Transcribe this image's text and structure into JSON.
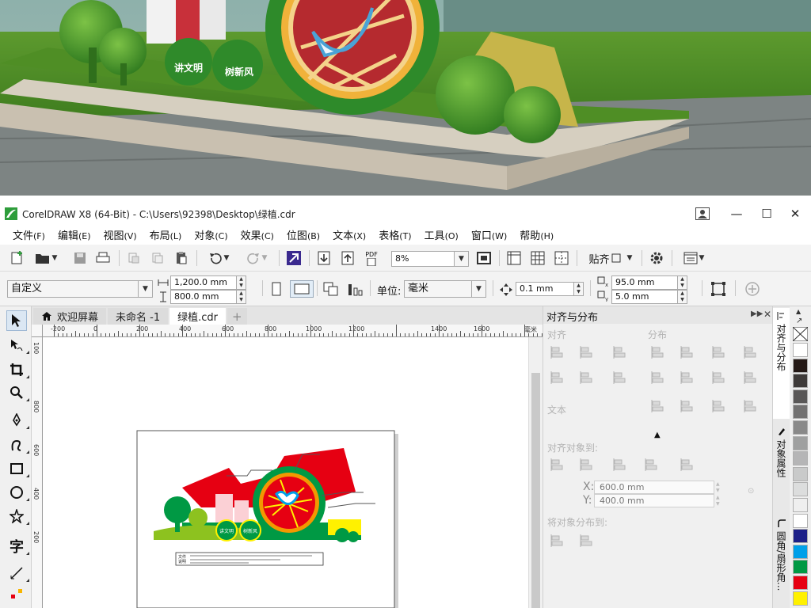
{
  "window": {
    "title": "CorelDRAW X8 (64-Bit) - C:\\Users\\92398\\Desktop\\绿植.cdr",
    "minimize_glyph": "—",
    "maximize_glyph": "☐",
    "close_glyph": "✕"
  },
  "render_scene": {
    "sign_text_left": "讲文明",
    "sign_text_right": "树新风"
  },
  "menu": [
    {
      "label": "文件",
      "accel": "(F)"
    },
    {
      "label": "编辑",
      "accel": "(E)"
    },
    {
      "label": "视图",
      "accel": "(V)"
    },
    {
      "label": "布局",
      "accel": "(L)"
    },
    {
      "label": "对象",
      "accel": "(C)"
    },
    {
      "label": "效果",
      "accel": "(C)"
    },
    {
      "label": "位图",
      "accel": "(B)"
    },
    {
      "label": "文本",
      "accel": "(X)"
    },
    {
      "label": "表格",
      "accel": "(T)"
    },
    {
      "label": "工具",
      "accel": "(O)"
    },
    {
      "label": "窗口",
      "accel": "(W)"
    },
    {
      "label": "帮助",
      "accel": "(H)"
    }
  ],
  "toolbar": {
    "zoom_value": "8%",
    "snap_label": "贴齐",
    "pdf_label": "PDF"
  },
  "propbar": {
    "paper_preset": "自定义",
    "width_value": "1,200.0 mm",
    "height_value": "800.0 mm",
    "units_label": "单位:",
    "units_value": "毫米",
    "nudge_value": "0.1 mm",
    "dup_x_value": "95.0 mm",
    "dup_y_value": "5.0 mm"
  },
  "tabs": [
    {
      "label": "欢迎屏幕",
      "active": false
    },
    {
      "label": "未命名 -1",
      "active": false
    },
    {
      "label": "绿植.cdr",
      "active": true
    }
  ],
  "ruler": {
    "h_labels": [
      "-200",
      "0",
      "200",
      "400",
      "600",
      "800",
      "1000",
      "1200",
      "1400",
      "1600"
    ],
    "h_unit": "毫米",
    "v_labels": [
      "100",
      "800",
      "600",
      "400",
      "200"
    ]
  },
  "canvas": {
    "sign_text_left": "讲文明",
    "sign_text_right": "树新风",
    "caption": "文件\n说明"
  },
  "docker": {
    "title": "对齐与分布",
    "align_section": "对齐",
    "distribute_section": "分布",
    "text_section": "文本",
    "align_to_section": "对齐对象到:",
    "x_label": "X:",
    "x_value": "600.0 mm",
    "y_label": "Y:",
    "y_value": "400.0 mm",
    "distribute_to_section": "将对象分布到:"
  },
  "vertical_tabs": [
    {
      "label": "对齐与分布",
      "active": true
    },
    {
      "label": "对象属性",
      "active": false
    },
    {
      "label": "圆角/扇形角...",
      "active": false
    }
  ],
  "palette_colors": [
    "#ffffff",
    "#231815",
    "#3e3a39",
    "#595757",
    "#727171",
    "#898989",
    "#9fa0a0",
    "#b5b5b6",
    "#c9caca",
    "#dcdddd",
    "#efefef",
    "#ffffff",
    "#1d2088",
    "#00a0e9",
    "#009944",
    "#e60012",
    "#fff100"
  ]
}
